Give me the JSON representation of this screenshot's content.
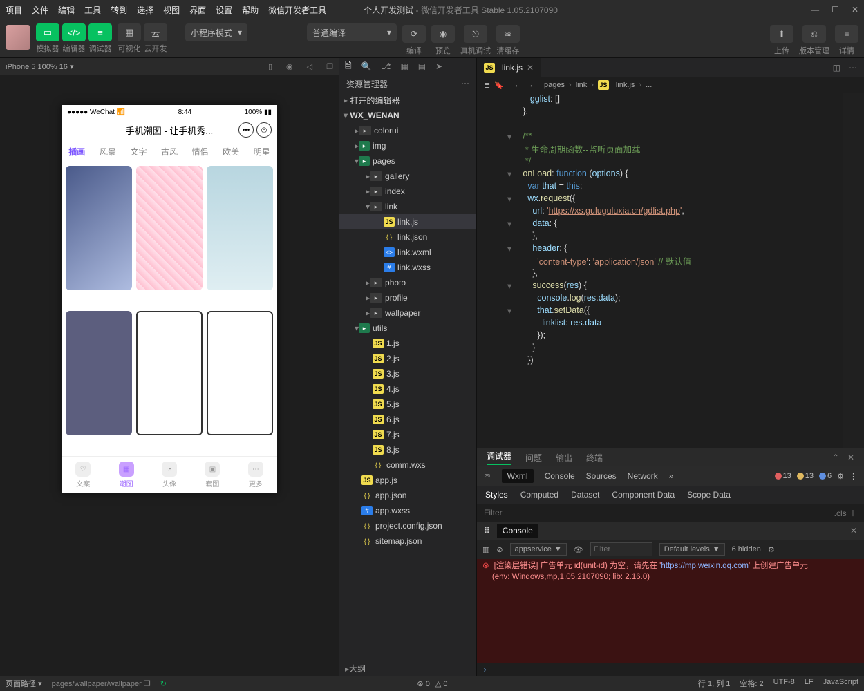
{
  "menus": [
    "项目",
    "文件",
    "编辑",
    "工具",
    "转到",
    "选择",
    "视图",
    "界面",
    "设置",
    "帮助",
    "微信开发者工具"
  ],
  "title_app": "个人开发测试",
  "title_suffix": " - 微信开发者工具 Stable 1.05.2107090",
  "toolbar": {
    "sim": "模拟器",
    "editor": "编辑器",
    "debug": "调试器",
    "vis": "可视化",
    "cloud": "云开发",
    "mode": "小程序模式",
    "compile_mode": "普通编译",
    "compile": "编译",
    "preview": "预览",
    "real": "真机调试",
    "clear": "清缓存",
    "upload": "上传",
    "version": "版本管理",
    "detail": "详情"
  },
  "simbar": {
    "device": "iPhone 5 100% 16"
  },
  "phone": {
    "carrier": "●●●●● WeChat",
    "time": "8:44",
    "batt": "100%",
    "title": "手机潮图 - 让手机秀...",
    "tabs": [
      "插画",
      "风景",
      "文字",
      "古风",
      "情侣",
      "欧美",
      "明星"
    ],
    "bottom": [
      "文案",
      "潮图",
      "头像",
      "套图",
      "更多"
    ]
  },
  "explorer": {
    "title": "资源管理器",
    "sections": {
      "open": "打开的编辑器",
      "proj": "WX_WENAN"
    },
    "tree": [
      {
        "d": 1,
        "t": "folder",
        "n": "colorui"
      },
      {
        "d": 1,
        "t": "foldg",
        "n": "img"
      },
      {
        "d": 1,
        "t": "foldg",
        "n": "pages",
        "open": true
      },
      {
        "d": 2,
        "t": "folder",
        "n": "gallery"
      },
      {
        "d": 2,
        "t": "folder",
        "n": "index"
      },
      {
        "d": 2,
        "t": "folder",
        "n": "link",
        "open": true
      },
      {
        "d": 3,
        "t": "js",
        "n": "link.js",
        "sel": true
      },
      {
        "d": 3,
        "t": "json",
        "n": "link.json"
      },
      {
        "d": 3,
        "t": "wxml",
        "n": "link.wxml"
      },
      {
        "d": 3,
        "t": "wxss",
        "n": "link.wxss"
      },
      {
        "d": 2,
        "t": "folder",
        "n": "photo"
      },
      {
        "d": 2,
        "t": "folder",
        "n": "profile"
      },
      {
        "d": 2,
        "t": "folder",
        "n": "wallpaper"
      },
      {
        "d": 1,
        "t": "foldg",
        "n": "utils",
        "open": true
      },
      {
        "d": 2,
        "t": "js",
        "n": "1.js"
      },
      {
        "d": 2,
        "t": "js",
        "n": "2.js"
      },
      {
        "d": 2,
        "t": "js",
        "n": "3.js"
      },
      {
        "d": 2,
        "t": "js",
        "n": "4.js"
      },
      {
        "d": 2,
        "t": "js",
        "n": "5.js"
      },
      {
        "d": 2,
        "t": "js",
        "n": "6.js"
      },
      {
        "d": 2,
        "t": "js",
        "n": "7.js"
      },
      {
        "d": 2,
        "t": "js",
        "n": "8.js"
      },
      {
        "d": 2,
        "t": "json",
        "n": "comm.wxs"
      },
      {
        "d": 1,
        "t": "js",
        "n": "app.js"
      },
      {
        "d": 1,
        "t": "json",
        "n": "app.json"
      },
      {
        "d": 1,
        "t": "wxss",
        "n": "app.wxss"
      },
      {
        "d": 1,
        "t": "json",
        "n": "project.config.json"
      },
      {
        "d": 1,
        "t": "json",
        "n": "sitemap.json"
      }
    ],
    "outline": "大纲"
  },
  "editor": {
    "tab": "link.js",
    "crumbs": [
      "pages",
      "link",
      "link.js",
      "..."
    ],
    "lines": [
      {
        "g": "",
        "f": "",
        "h": "      <span class='tok-v'>gglist</span><span class='tok-p'>: []</span>"
      },
      {
        "g": "",
        "f": "",
        "h": "   <span class='tok-p'>},</span>"
      },
      {
        "g": "",
        "f": "",
        "h": ""
      },
      {
        "g": "",
        "f": "▾",
        "h": "   <span class='tok-c'>/**</span>"
      },
      {
        "g": "",
        "f": "",
        "h": "   <span class='tok-c'> * 生命周期函数--监听页面加载</span>"
      },
      {
        "g": "",
        "f": "",
        "h": "   <span class='tok-c'> */</span>"
      },
      {
        "g": "",
        "f": "▾",
        "h": "   <span class='tok-f'>onLoad</span><span class='tok-p'>: </span><span class='tok-k'>function</span> <span class='tok-p'>(</span><span class='tok-v'>options</span><span class='tok-p'>) {</span>"
      },
      {
        "g": "",
        "f": "",
        "h": "     <span class='tok-k'>var</span> <span class='tok-v'>that</span> <span class='tok-p'>=</span> <span class='tok-k'>this</span><span class='tok-p'>;</span>"
      },
      {
        "g": "",
        "f": "▾",
        "h": "     <span class='tok-v'>wx</span><span class='tok-p'>.</span><span class='tok-f'>request</span><span class='tok-p'>({</span>"
      },
      {
        "g": "",
        "f": "",
        "h": "       <span class='tok-v'>url</span><span class='tok-p'>: </span><span class='tok-s'>'</span><span class='tok-u'>https://xs.guluguluxia.cn/gdlist.php</span><span class='tok-s'>'</span><span class='tok-p'>,</span>"
      },
      {
        "g": "",
        "f": "▾",
        "h": "       <span class='tok-v'>data</span><span class='tok-p'>: {</span>"
      },
      {
        "g": "",
        "f": "",
        "h": "       <span class='tok-p'>},</span>"
      },
      {
        "g": "",
        "f": "▾",
        "h": "       <span class='tok-v'>header</span><span class='tok-p'>: {</span>"
      },
      {
        "g": "",
        "f": "",
        "h": "         <span class='tok-s'>'content-type'</span><span class='tok-p'>: </span><span class='tok-s'>'application/json'</span> <span class='tok-c'>// 默认值</span>"
      },
      {
        "g": "",
        "f": "",
        "h": "       <span class='tok-p'>},</span>"
      },
      {
        "g": "",
        "f": "▾",
        "h": "       <span class='tok-f'>success</span><span class='tok-p'>(</span><span class='tok-v'>res</span><span class='tok-p'>) {</span>"
      },
      {
        "g": "",
        "f": "",
        "h": "         <span class='tok-v'>console</span><span class='tok-p'>.</span><span class='tok-f'>log</span><span class='tok-p'>(</span><span class='tok-v'>res</span><span class='tok-p'>.</span><span class='tok-v'>data</span><span class='tok-p'>);</span>"
      },
      {
        "g": "",
        "f": "▾",
        "h": "         <span class='tok-v'>that</span><span class='tok-p'>.</span><span class='tok-f'>setData</span><span class='tok-p'>({</span>"
      },
      {
        "g": "",
        "f": "",
        "h": "           <span class='tok-v'>linklist</span><span class='tok-p'>: </span><span class='tok-v'>res</span><span class='tok-p'>.</span><span class='tok-v'>data</span>"
      },
      {
        "g": "",
        "f": "",
        "h": "         <span class='tok-p'>});</span>"
      },
      {
        "g": "",
        "f": "",
        "h": "       <span class='tok-p'>}</span>"
      },
      {
        "g": "",
        "f": "",
        "h": "     <span class='tok-p'>})</span>"
      }
    ]
  },
  "dbg": {
    "tabs": [
      "调试器",
      "问题",
      "输出",
      "终端"
    ],
    "dev": [
      "Wxml",
      "Console",
      "Sources",
      "Network"
    ],
    "counts": {
      "err": "13",
      "warn": "13",
      "info": "6"
    },
    "styles": [
      "Styles",
      "Computed",
      "Dataset",
      "Component Data",
      "Scope Data"
    ],
    "filter": "Filter",
    "cls": ".cls",
    "console": "Console",
    "ctx": "appservice",
    "levels": "Default levels",
    "hidden": "6 hidden",
    "err1": "[渲染层错误] 广告单元 id(unit-id) 为空，请先在 '",
    "errlink": "https://mp.weixin.qq.com",
    "err1b": "' 上创建广告单元",
    "err2": "(env: Windows,mp,1.05.2107090; lib: 2.16.0)"
  },
  "status": {
    "left_label": "页面路径",
    "left_path": "pages/wallpaper/wallpaper",
    "mid_a": "0",
    "mid_b": "0",
    "r": [
      "行 1, 列 1",
      "空格: 2",
      "UTF-8",
      "LF",
      "JavaScript"
    ]
  }
}
